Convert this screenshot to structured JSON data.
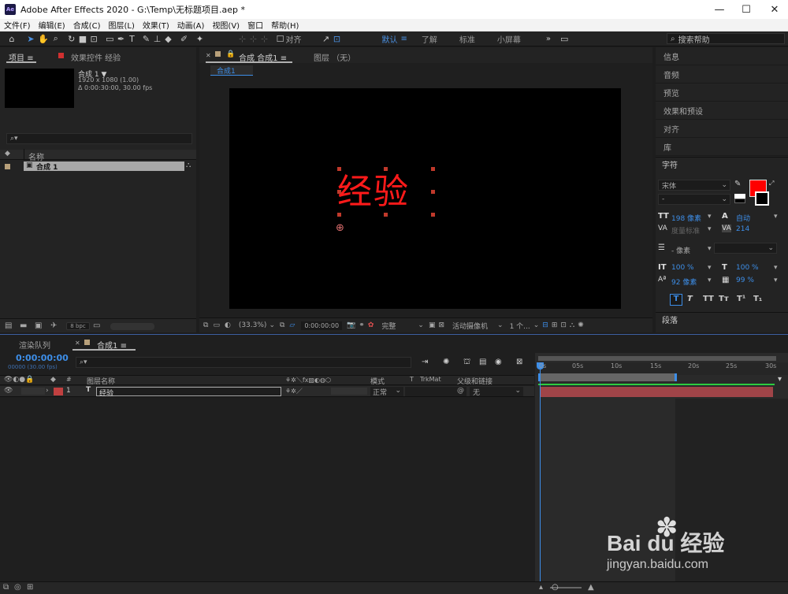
{
  "window": {
    "title": "Adobe After Effects 2020 - G:\\Temp\\无标题项目.aep *",
    "app_icon": "Ae",
    "controls": [
      "—",
      "☐",
      "✕"
    ]
  },
  "menu": [
    "文件(F)",
    "编辑(E)",
    "合成(C)",
    "图层(L)",
    "效果(T)",
    "动画(A)",
    "视图(V)",
    "窗口",
    "帮助(H)"
  ],
  "toolbar": {
    "snap_label": "对齐",
    "workspaces": [
      "默认",
      "了解",
      "标准",
      "小屏幕"
    ],
    "active_workspace": 0,
    "more": "»",
    "search_placeholder": "搜索帮助"
  },
  "project": {
    "tab": "项目",
    "tab_menu": "≡",
    "effects_tab": "效果控件 经验",
    "comp_name": "合成 1 ▼",
    "comp_res": "1920 x 1080 (1.00)",
    "comp_dur": "Δ 0:00:30:00, 30.00 fps",
    "search_icon_text": "⌕▾",
    "col_name": "名称",
    "items": [
      {
        "name": "合成 1"
      }
    ],
    "bpc": "8 bpc"
  },
  "viewer": {
    "tab": "合成 合成1",
    "tab_menu": "≡",
    "layer_tab": "图层 （无）",
    "breadcrumb": "合成1",
    "text": "经验",
    "zoom": "(33.3%)",
    "time": "0:00:00:00",
    "quality": "完整",
    "camera": "活动摄像机",
    "views": "1 个..."
  },
  "right_panels": [
    "信息",
    "音频",
    "预览",
    "效果和预设",
    "对齐",
    "库"
  ],
  "character": {
    "title": "字符",
    "font": "宋体",
    "style": "-",
    "size": "198 像素",
    "leading": "自动",
    "kerning": "度量标准",
    "tracking": "214",
    "stroke": "- 像素",
    "vscale": "100 %",
    "hscale": "100 %",
    "baseline": "92 像素",
    "tsume": "99 %",
    "styles": [
      "T",
      "T",
      "TT",
      "Tт",
      "T¹",
      "T₁"
    ],
    "fill_color": "#ff0000"
  },
  "paragraph": {
    "title": "段落"
  },
  "timeline": {
    "render_tab": "渲染队列",
    "comp_tab": "合成1",
    "tab_menu": "≡",
    "timecode": "0:00:00:00",
    "fps": "00000 (30.00 fps)",
    "col_layer_name": "图层名称",
    "col_mode": "模式",
    "col_t": "T",
    "col_trkmat": "TrkMat",
    "col_parent": "父级和链接",
    "col_num": "#",
    "layer": {
      "num": "1",
      "name": "经验",
      "mode": "正常",
      "parent": "无"
    },
    "ruler": [
      "0s",
      "05s",
      "10s",
      "15s",
      "20s",
      "25s",
      "30s"
    ]
  },
  "watermark": {
    "line1": "Bai du 经验",
    "line2": "jingyan.baidu.com"
  }
}
